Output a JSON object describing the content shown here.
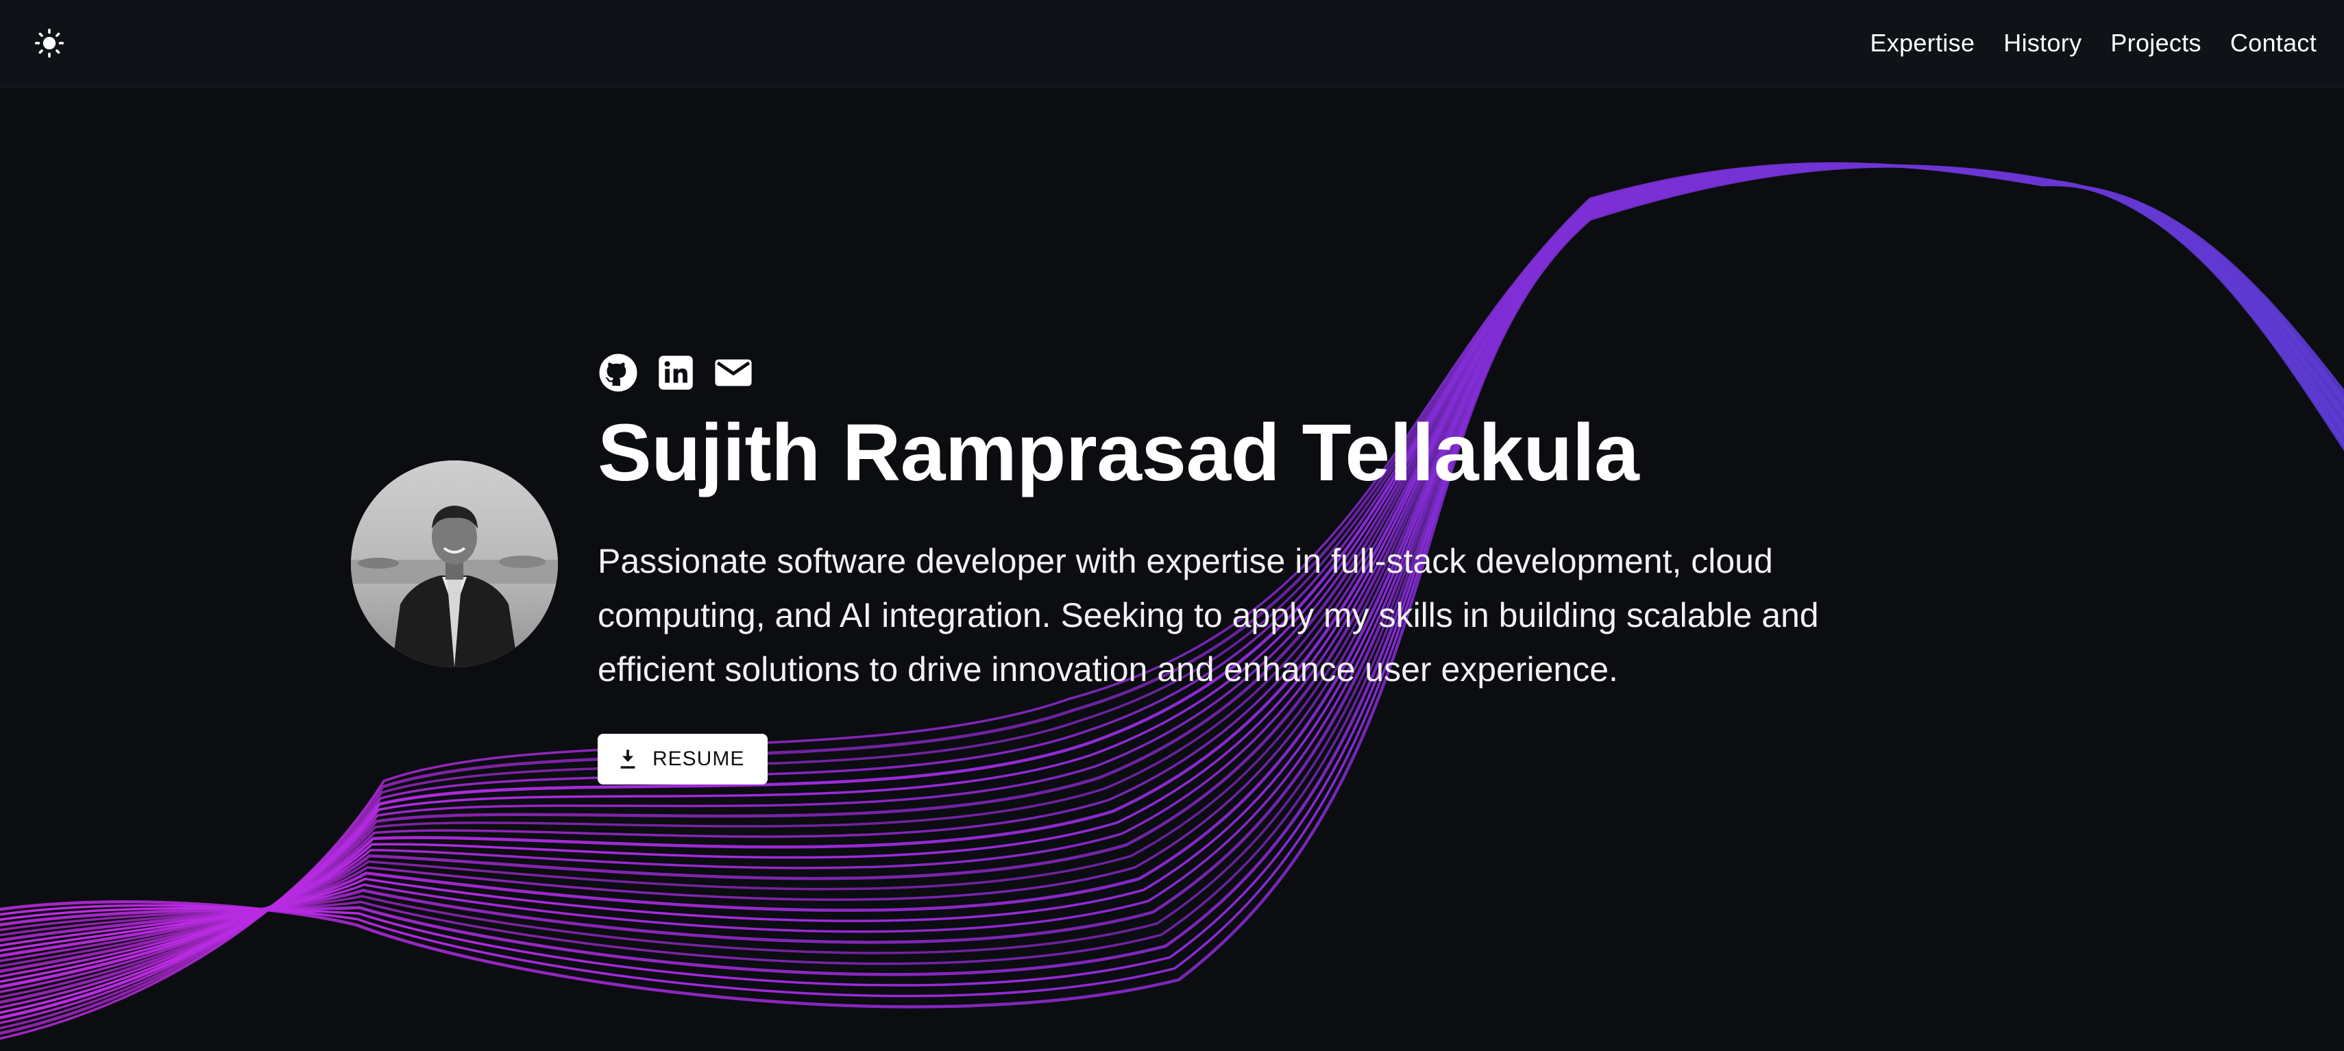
{
  "nav": {
    "theme_icon": "sun-icon",
    "links": [
      {
        "label": "Expertise"
      },
      {
        "label": "History"
      },
      {
        "label": "Projects"
      },
      {
        "label": "Contact"
      }
    ]
  },
  "hero": {
    "social_icons": [
      "github-icon",
      "linkedin-icon",
      "mail-icon"
    ],
    "name": "Sujith Ramprasad Tellakula",
    "summary": "Passionate software developer with expertise in full-stack development, cloud computing, and AI integration. Seeking to apply my skills in building scalable and efficient solutions to drive innovation and enhance user experience.",
    "resume_label": "RESUME",
    "resume_icon": "download-icon"
  },
  "colors": {
    "background": "#0b0d11",
    "navbar": "#0f1216",
    "wave_start": "#c026e8",
    "wave_end": "#5b3fd6",
    "text": "#ffffff"
  }
}
